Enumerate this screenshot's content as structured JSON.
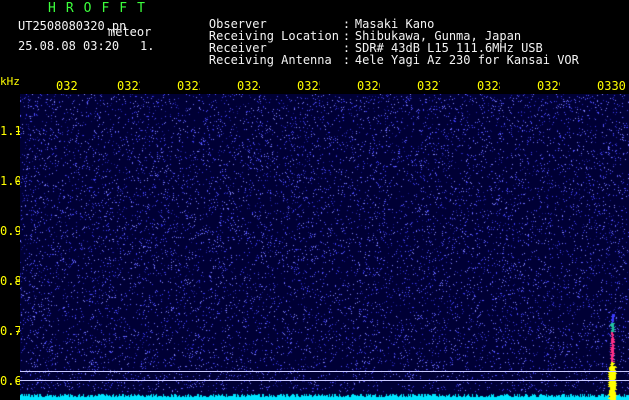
{
  "header": {
    "app_logo": "HROFFT",
    "file_name": "UT2508080320.pn",
    "mode_label": "meteor",
    "datetime": "25.08.08 03:20",
    "gain_value": "1.",
    "info": [
      {
        "label": "Observer",
        "sep": ":",
        "value": "Masaki Kano"
      },
      {
        "label": "Receiving Location",
        "sep": ":",
        "value": "Shibukawa, Gunma, Japan"
      },
      {
        "label": "Receiver",
        "sep": ":",
        "value": "SDR# 43dB L15 111.6MHz USB"
      },
      {
        "label": "Receiving Antenna",
        "sep": ":",
        "value": "4ele Yagi Az 230 for Kansai VOR"
      }
    ]
  },
  "axes": {
    "unit_label": "kHz",
    "x_ticks": [
      "0321",
      "0322",
      "0323",
      "0324",
      "0325",
      "0326",
      "0327",
      "0328",
      "0329",
      "0330"
    ],
    "y_ticks": [
      "1.1",
      "1.0",
      "0.9",
      "0.8",
      "0.7",
      "0.6"
    ],
    "y_range": [
      0.58,
      1.19
    ]
  },
  "colors": {
    "background": "#000000",
    "plot_background": "#000035",
    "noise": "#3c3cff",
    "axis_text": "#ffff00",
    "logo": "#3cff3c",
    "baseline": "#00e5ff",
    "meteor_core": "#ffff00",
    "meteor_mid": "#ff2e88",
    "reference_line": "#c9c9ff"
  }
}
